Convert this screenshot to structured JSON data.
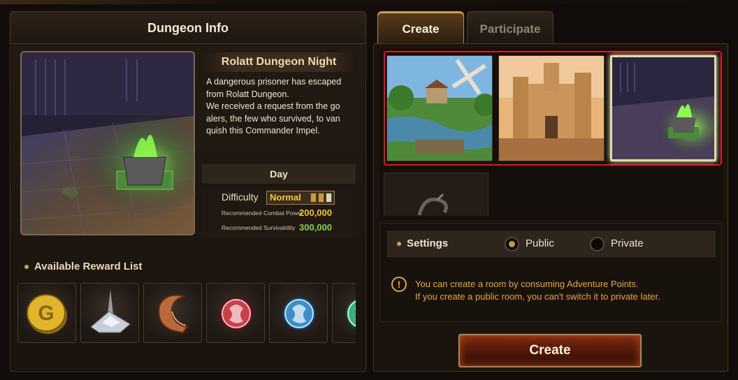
{
  "dungeon_info": {
    "title": "Dungeon Info",
    "name": "Rolatt Dungeon Night",
    "description": "A dangerous prisoner has escaped\nfrom Rolatt Dungeon.\nWe received a request from the go\nalers, the few who survived, to van\nquish this Commander Impel.",
    "time_of_day": "Day",
    "difficulty_label": "Difficulty",
    "difficulty_value": "Normal",
    "combat_power_label": "Recommended Combat Power",
    "combat_power_value": "200,000",
    "survivability_label": "Recommended Survivability",
    "survivability_value": "300,000"
  },
  "rewards": {
    "title": "Available Reward List",
    "items": [
      {
        "icon": "gold-coin-icon"
      },
      {
        "icon": "silver-ore-icon"
      },
      {
        "icon": "horn-icon"
      },
      {
        "icon": "red-rune-orb-icon"
      },
      {
        "icon": "blue-rune-orb-icon"
      },
      {
        "icon": "green-rune-orb-icon"
      }
    ]
  },
  "tabs": {
    "create": "Create",
    "participate": "Participate"
  },
  "maps": [
    {
      "name": "windmill-village-map",
      "selected": false
    },
    {
      "name": "desert-castle-map",
      "selected": false
    },
    {
      "name": "dungeon-night-map",
      "selected": true
    },
    {
      "name": "dark-serpent-map",
      "selected": false
    }
  ],
  "settings": {
    "label": "Settings",
    "public_label": "Public",
    "private_label": "Private",
    "selected": "Public"
  },
  "notice": {
    "line1": "You can create a room by consuming Adventure Points.",
    "line2": "If you create a public room, you can't switch it to private later."
  },
  "create_button": "Create",
  "colors": {
    "accent_gold": "#c9a255",
    "selection_red": "#e3141e",
    "notice_orange": "#e7a63d",
    "power_yellow": "#f4c542",
    "survivability_green": "#8ad04a"
  }
}
